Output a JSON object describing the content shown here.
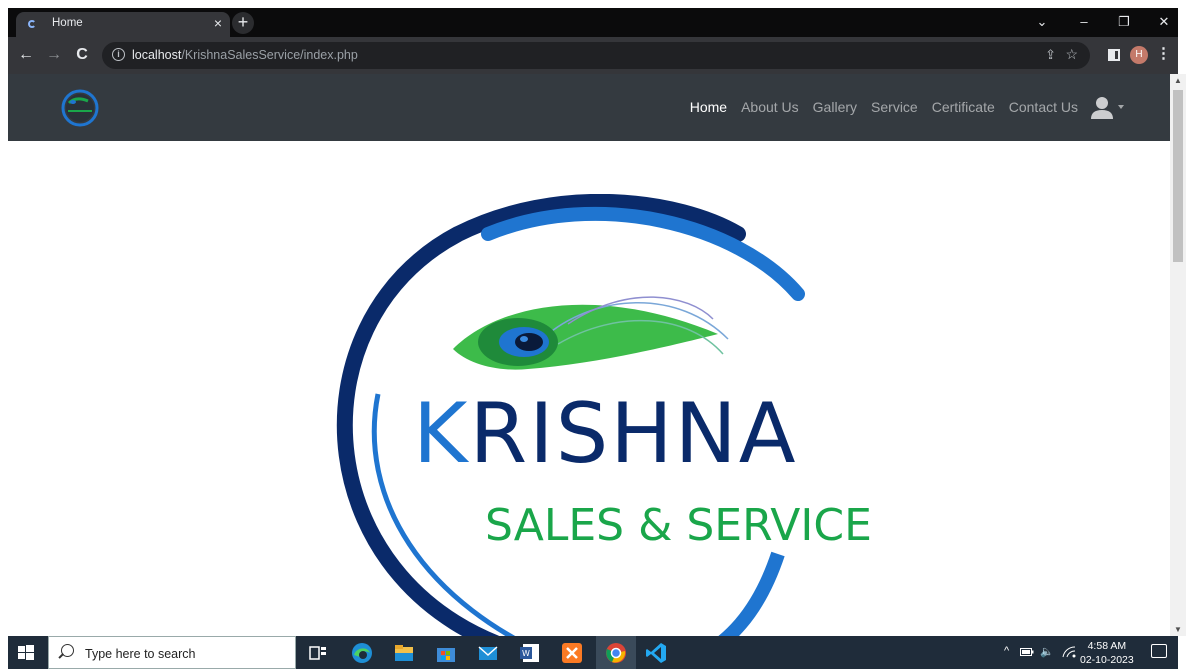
{
  "browser": {
    "tab": {
      "title": "Home",
      "close": "×"
    },
    "new_tab": "+",
    "window_controls": {
      "chevron": "⌄",
      "minimize": "–",
      "restore": "❐",
      "close": "✕"
    },
    "nav": {
      "back": "←",
      "forward": "→",
      "reload": "C"
    },
    "address": {
      "info_icon": "i",
      "host": "localhost",
      "path": "/KrishnaSalesService/index.php"
    },
    "profile_initial": "H",
    "menu": "⋮"
  },
  "site": {
    "nav_items": [
      {
        "label": "Home",
        "active": true
      },
      {
        "label": "About Us",
        "active": false
      },
      {
        "label": "Gallery",
        "active": false
      },
      {
        "label": "Service",
        "active": false
      },
      {
        "label": "Certificate",
        "active": false
      },
      {
        "label": "Contact Us",
        "active": false
      }
    ],
    "logo": {
      "name": "KRISHNA",
      "tagline": "SALES & SERVICE",
      "colors": {
        "dark_blue": "#0a2a6a",
        "blue": "#1f75d0",
        "green": "#1aa64a"
      }
    }
  },
  "taskbar": {
    "search_placeholder": "Type here to search",
    "time": "4:58 AM",
    "date": "02-10-2023",
    "tray": {
      "chevron": "^",
      "speaker": "🔈"
    }
  },
  "colors": {
    "navbar": "#343a40",
    "taskbar": "#1f2c3a",
    "chrome": "#35363a"
  }
}
